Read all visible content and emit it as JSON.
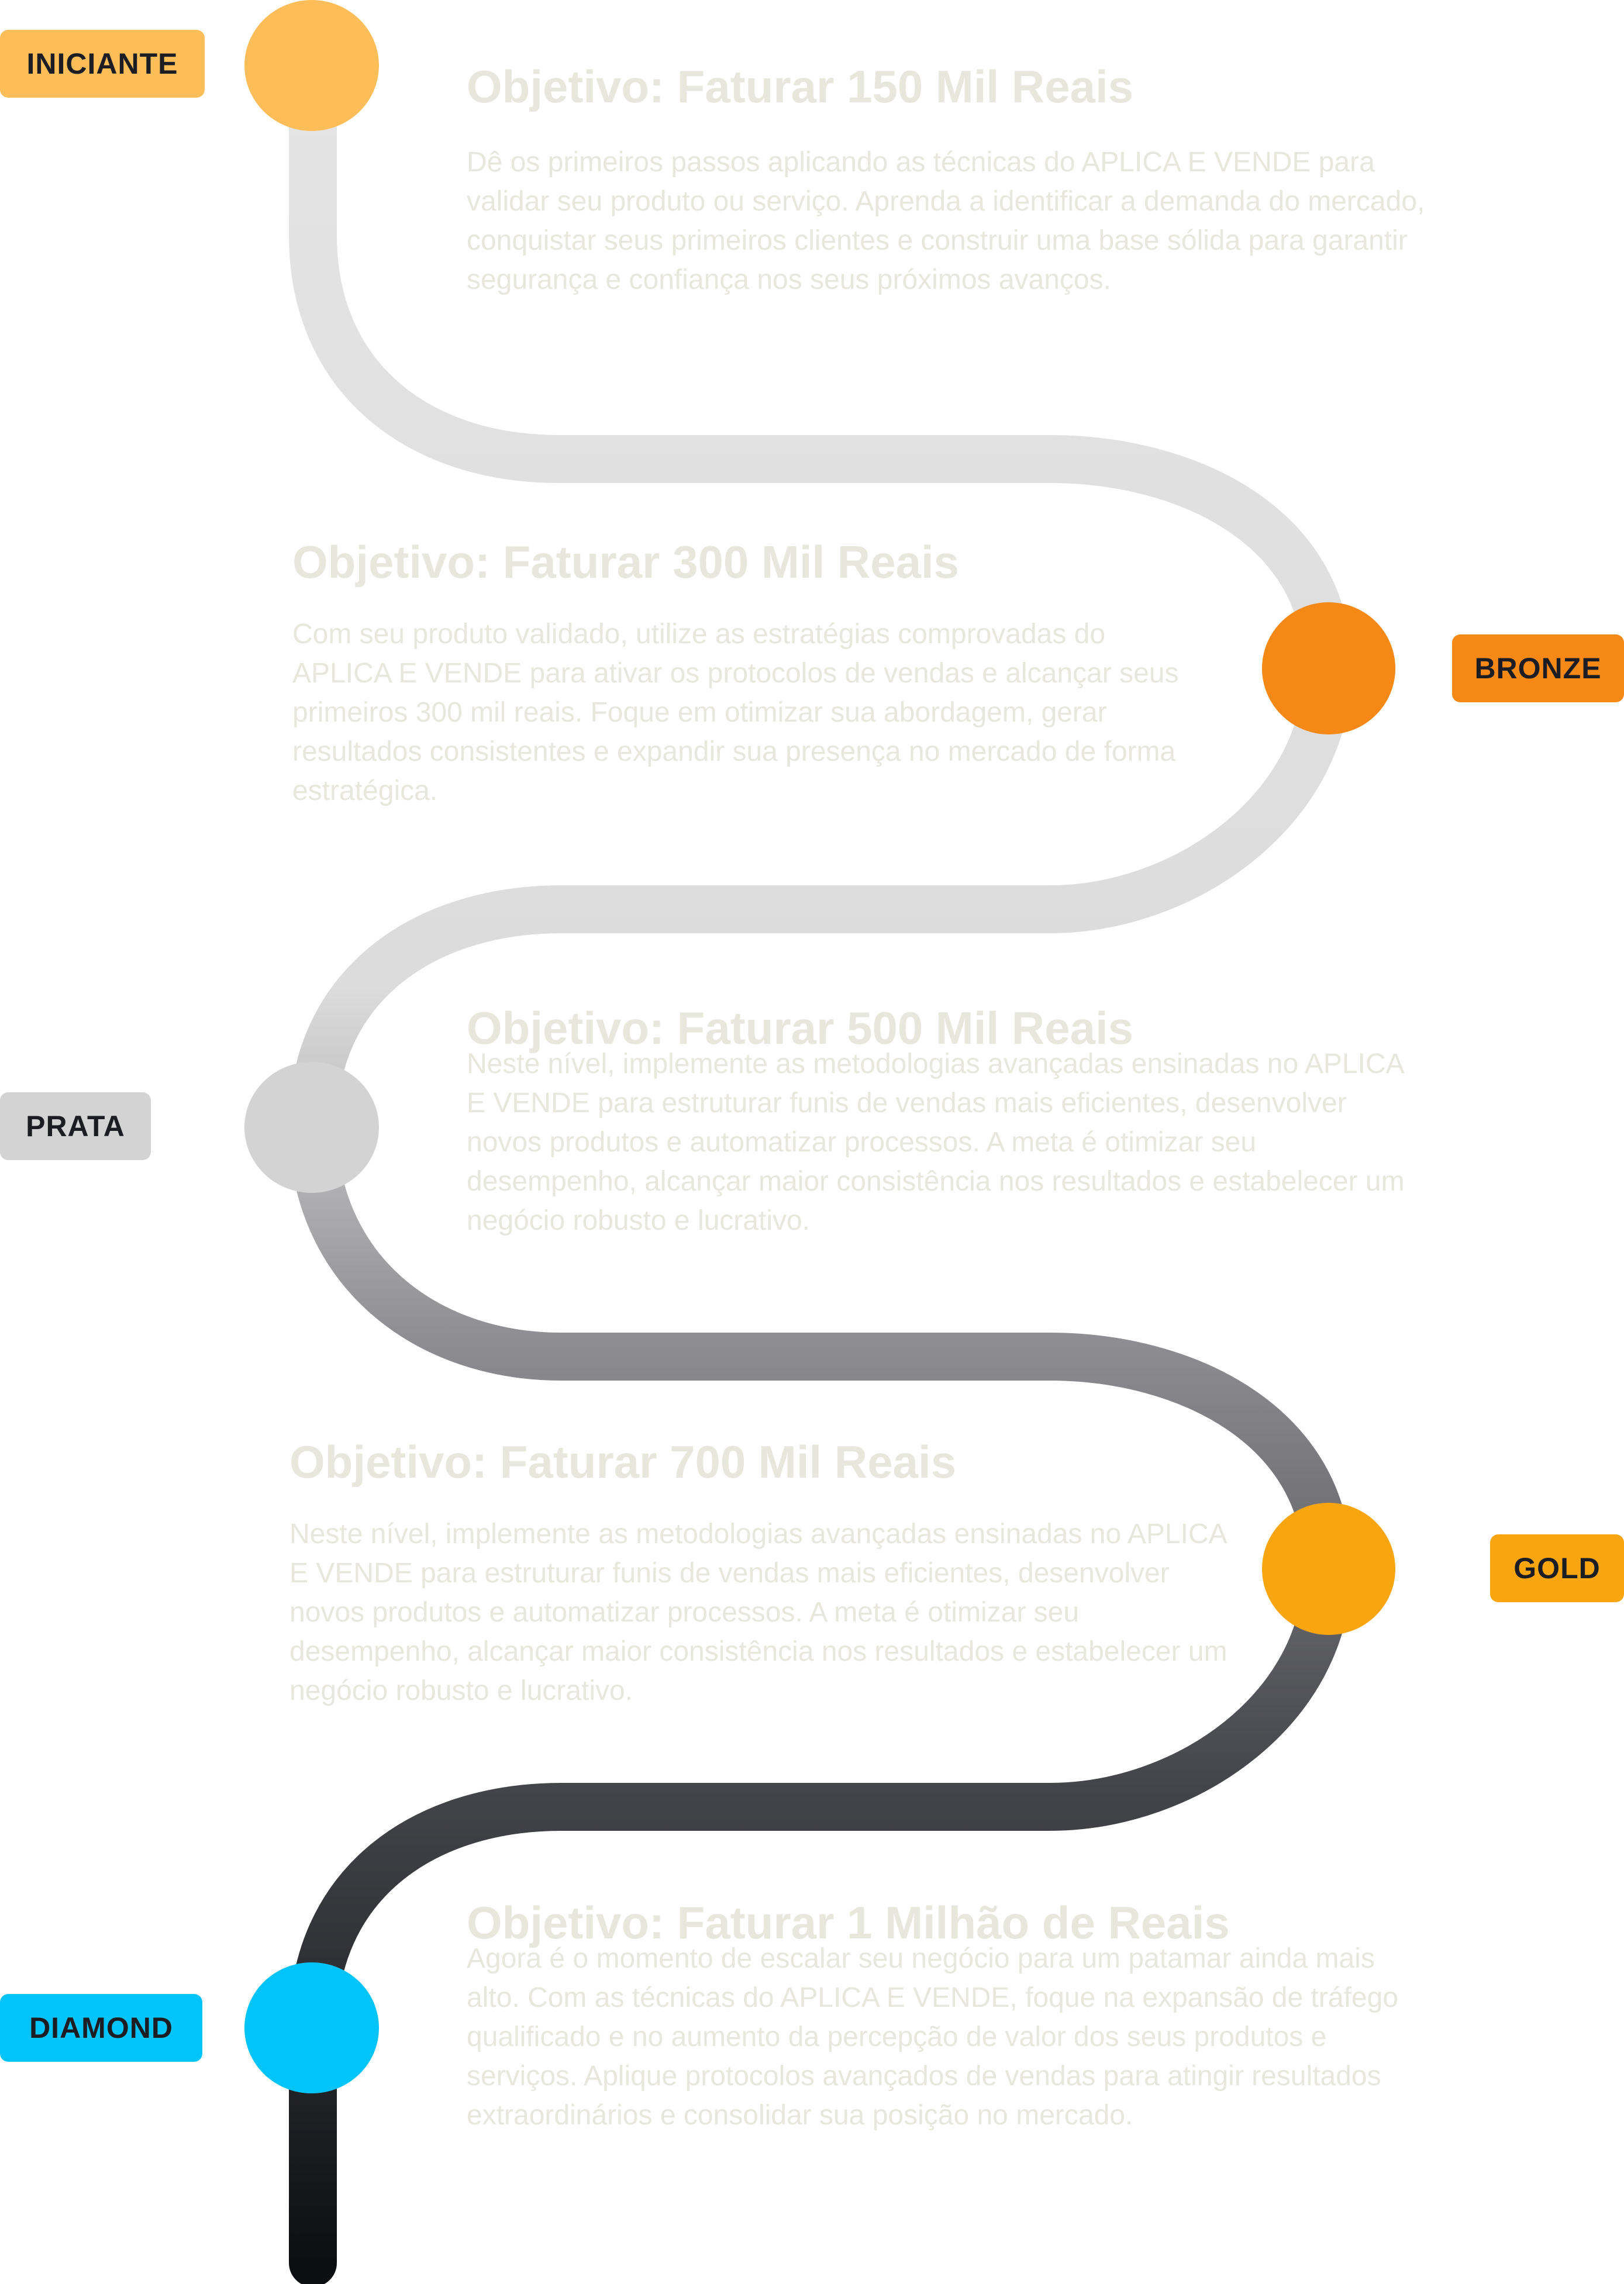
{
  "colors": {
    "text": "#e7e7dd",
    "badge_text": "#1c1d22",
    "path_top": "#e4e4e4",
    "path_mid": "#8e8e92",
    "path_bottom": "#0d0e12"
  },
  "levels": [
    {
      "id": "iniciante",
      "badge": "INICIANTE",
      "color": "#fdbe5a",
      "title": "Objetivo: Faturar 150 Mil Reais",
      "body": "Dê os primeiros passos aplicando as técnicas do APLICA E VENDE para validar seu produto ou serviço. Aprenda a identificar a demanda do mercado, conquistar seus primeiros clientes e construir uma base sólida para garantir segurança e confiança nos seus próximos avanços."
    },
    {
      "id": "bronze",
      "badge": "BRONZE",
      "color": "#f68816",
      "title": "Objetivo: Faturar 300 Mil Reais",
      "body": "Com seu produto validado, utilize as estratégias comprovadas do APLICA E VENDE para ativar os protocolos de vendas e alcançar seus primeiros 300 mil reais. Foque em otimizar sua abordagem, gerar resultados consistentes e expandir sua presença no mercado de forma estratégica."
    },
    {
      "id": "prata",
      "badge": "PRATA",
      "color": "#d3d3d3",
      "title": "Objetivo: Faturar 500 Mil Reais",
      "body": "Neste nível, implemente as metodologias avançadas ensinadas no APLICA E VENDE para estruturar funis de vendas mais eficientes, desenvolver novos produtos e automatizar processos. A meta é otimizar seu desempenho, alcançar maior consistência nos resultados e estabelecer um negócio robusto e lucrativo."
    },
    {
      "id": "gold",
      "badge": "GOLD",
      "color": "#f9a50f",
      "title": "Objetivo: Faturar 700 Mil Reais",
      "body": "Neste nível, implemente as metodologias avançadas ensinadas no APLICA E VENDE para estruturar funis de vendas mais eficientes, desenvolver novos produtos e automatizar processos. A meta é otimizar seu desempenho, alcançar maior consistência nos resultados e estabelecer um negócio robusto e lucrativo."
    },
    {
      "id": "diamond",
      "badge": "DIAMOND",
      "color": "#00c4fa",
      "title": "Objetivo: Faturar 1 Milhão de Reais",
      "body": "Agora é o momento de escalar seu negócio para um patamar ainda mais alto. Com as técnicas do APLICA E VENDE, foque na expansão de tráfego qualificado e no aumento da percepção de valor dos seus produtos e serviços. Aplique protocolos avançados de vendas para atingir resultados extraordinários e consolidar sua posição no mercado."
    }
  ]
}
